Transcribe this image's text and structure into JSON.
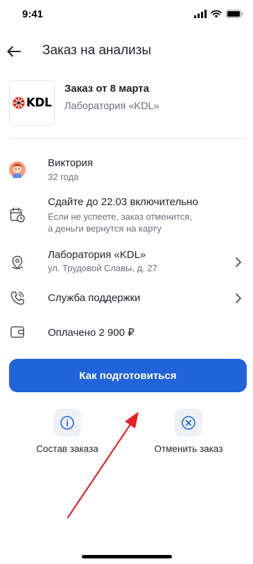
{
  "status": {
    "time": "9:41"
  },
  "header": {
    "title": "Заказ на анализы"
  },
  "order": {
    "title": "Заказ от 8 марта",
    "lab": "Лаборатория «KDL»",
    "logo_text": "KDL"
  },
  "rows": [
    {
      "icon": "avatar",
      "title": "Виктория",
      "subtitle": "32 года"
    },
    {
      "icon": "calendar-clock-icon",
      "title": "Сдайте до 22.03 включительно",
      "subtitle": "Если не успеете, заказ отменится,",
      "subtitle2": "а деньги вернутся на карту"
    },
    {
      "icon": "location-pin-icon",
      "title": "Лаборатория «KDL»",
      "subtitle": "ул. Трудовой Славы, д. 27"
    },
    {
      "icon": "phone-icon",
      "title": "Служба поддержки"
    },
    {
      "icon": "wallet-icon",
      "title": "Оплачено 2 900 ₽"
    }
  ],
  "primary_button": {
    "label": "Как подготовиться"
  },
  "actions": [
    {
      "icon": "info-icon",
      "label": "Состав заказа"
    },
    {
      "icon": "cancel-icon",
      "label": "Отменить заказ"
    }
  ],
  "colors": {
    "accent": "#2163d9",
    "annotation": "#e8202a"
  }
}
